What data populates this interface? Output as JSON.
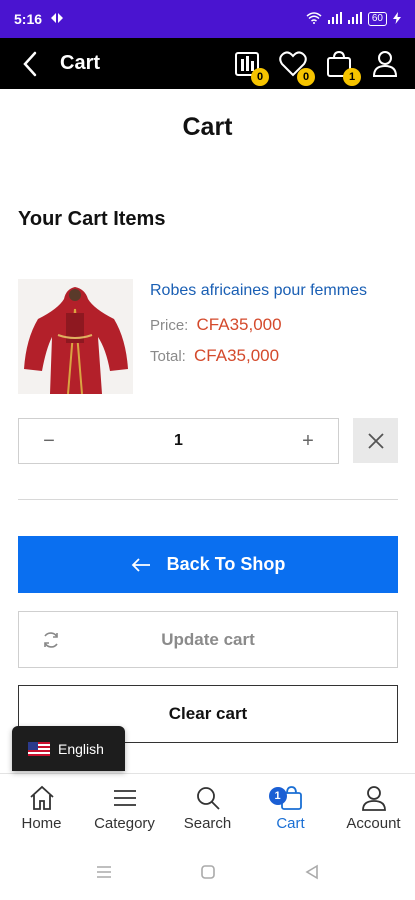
{
  "status_bar": {
    "time": "5:16",
    "battery": "60"
  },
  "app_bar": {
    "title": "Cart",
    "compare_count": "0",
    "wishlist_count": "0",
    "cart_count": "1"
  },
  "page": {
    "title": "Cart",
    "section_title": "Your Cart Items"
  },
  "cart_item": {
    "name": "Robes africaines pour femmes",
    "price_label": "Price:",
    "price_value": "CFA35,000",
    "total_label": "Total:",
    "total_value": "CFA35,000",
    "quantity": "1",
    "minus": "−",
    "plus": "+"
  },
  "buttons": {
    "back_to_shop": "Back To Shop",
    "update_cart": "Update cart",
    "clear_cart": "Clear cart"
  },
  "language": {
    "selected": "English"
  },
  "bottom_nav": {
    "items": [
      {
        "label": "Home",
        "icon": "home-icon"
      },
      {
        "label": "Category",
        "icon": "menu-icon"
      },
      {
        "label": "Search",
        "icon": "search-icon"
      },
      {
        "label": "Cart",
        "icon": "cart-icon",
        "badge": "1",
        "active": true
      },
      {
        "label": "Account",
        "icon": "user-icon"
      }
    ]
  },
  "colors": {
    "status_bar": "#4a14d0",
    "app_bar": "#000000",
    "badge": "#f6c400",
    "primary_button": "#0a6ff0",
    "price": "#d44a2c",
    "link": "#1a5fb4",
    "nav_active": "#1a6fd4"
  }
}
